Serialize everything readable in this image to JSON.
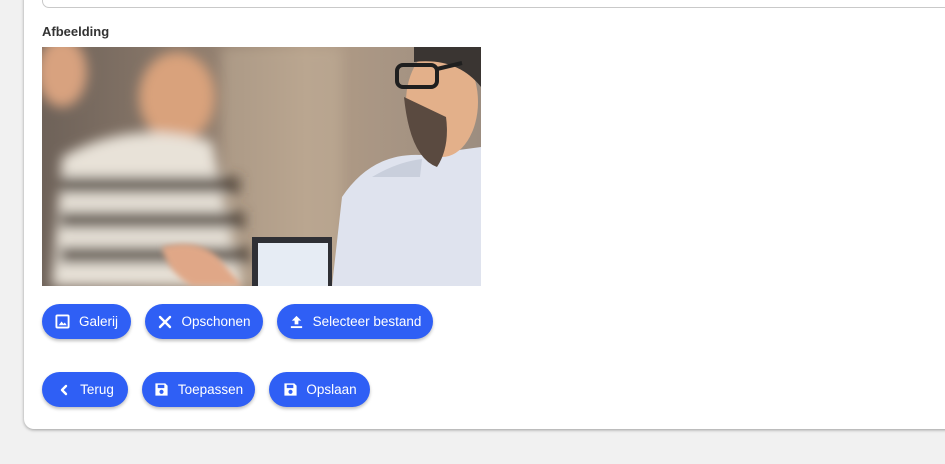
{
  "form": {
    "image_label": "Afbeelding"
  },
  "image": {
    "alt": "Zakelijke bespreking",
    "colors": {
      "skin": "#e3b08a",
      "shirt_light": "#dfe3ee",
      "background": "#8a7a6c",
      "accent": "#3a3a3a"
    }
  },
  "image_actions": {
    "gallery": {
      "label": "Galerij",
      "icon": "image-icon"
    },
    "clear": {
      "label": "Opschonen",
      "icon": "close-icon"
    },
    "upload": {
      "label": "Selecteer bestand",
      "icon": "upload-icon"
    }
  },
  "footer_actions": {
    "back": {
      "label": "Terug",
      "icon": "chevron-left-icon"
    },
    "apply": {
      "label": "Toepassen",
      "icon": "save-icon"
    },
    "save": {
      "label": "Opslaan",
      "icon": "save-icon"
    }
  },
  "theme": {
    "primary": "#2f5ff5",
    "page_background": "#f1f1f1",
    "card_background": "#ffffff"
  }
}
